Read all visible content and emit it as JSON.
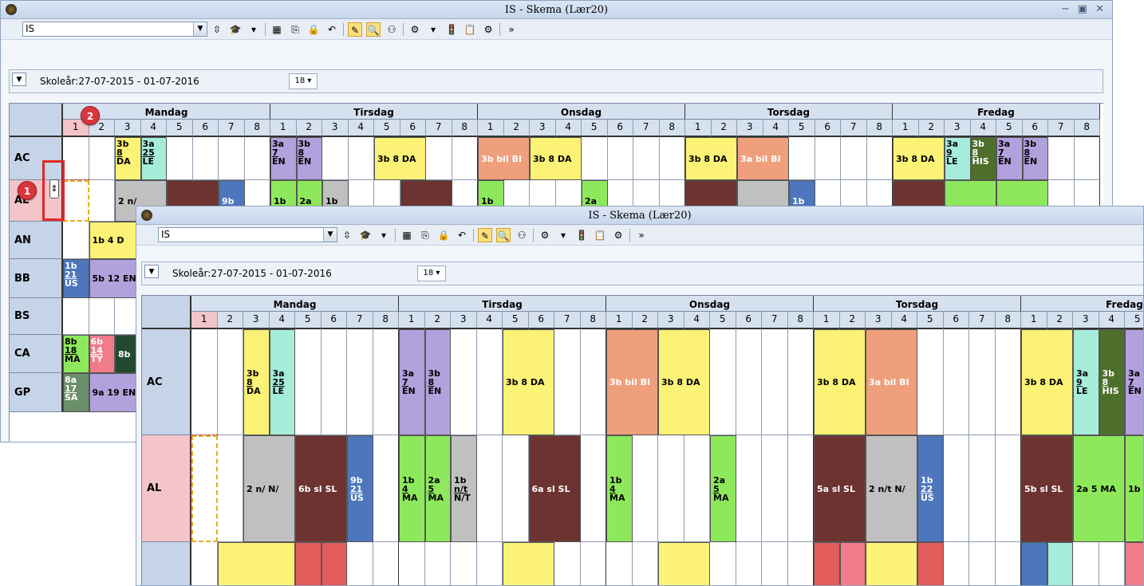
{
  "window_title": "IS -  Skema  (Lær20)",
  "window_controls": {
    "minimize": "−",
    "restore": "▣",
    "close": "✕"
  },
  "combo_value": "IS",
  "school_year": "Skoleår:27-07-2015 - 01-07-2016",
  "days": [
    "Mandag",
    "Tirsdag",
    "Onsdag",
    "Torsdag",
    "Fredag"
  ],
  "periods": [
    "1",
    "2",
    "3",
    "4",
    "5",
    "6",
    "7",
    "8"
  ],
  "teachers_back": [
    "AC",
    "AL",
    "AN",
    "BB",
    "BS",
    "CA",
    "GP"
  ],
  "teachers_front": [
    "AC",
    "AL"
  ],
  "badges": {
    "one": "1",
    "two": "2"
  },
  "toolbar_icons": [
    "stepper-icon",
    "graduation-cap-icon",
    "dropdown-icon",
    "grid-icon",
    "export-icon",
    "lock-icon",
    "undo-icon",
    "edit-highlight-icon",
    "search-icon",
    "people-icon",
    "settings-doc-icon",
    "dropdown-icon",
    "traffic-light-icon",
    "clipboard-icon",
    "gear-icon",
    "overflow-icon"
  ],
  "colors": {
    "yellow": "#fbf276",
    "teal": "#a6ecdb",
    "lilac": "#b1a1dc",
    "salmon": "#ef9f7c",
    "maroon": "#6c3331",
    "blue": "#4d76bd",
    "green": "#8ee85c",
    "grey": "#c0c0c0",
    "darkgreen": "#4e6f2a",
    "pink": "#f07c8a",
    "red": "#e25c5c",
    "forest": "#234a31",
    "olive": "#6b8e6b"
  },
  "lessons_back": [
    {
      "t": 0,
      "d": 0,
      "p": 2,
      "cls": "3b",
      "room": "8",
      "subj": "DA",
      "c": "yellow"
    },
    {
      "t": 0,
      "d": 0,
      "p": 3,
      "cls": "3a",
      "room": "25",
      "subj": "LE",
      "c": "teal"
    },
    {
      "t": 0,
      "d": 1,
      "p": 0,
      "cls": "3a",
      "room": "7",
      "subj": "EN",
      "c": "lilac"
    },
    {
      "t": 0,
      "d": 1,
      "p": 1,
      "cls": "3b",
      "room": "8",
      "subj": "EN",
      "c": "lilac"
    },
    {
      "t": 0,
      "d": 1,
      "p": 4,
      "span": 2,
      "text": "3b 8 DA",
      "c": "yellow"
    },
    {
      "t": 0,
      "d": 2,
      "p": 0,
      "span": 2,
      "text": "3b bil BI",
      "c": "salmon"
    },
    {
      "t": 0,
      "d": 2,
      "p": 2,
      "span": 2,
      "text": "3b 8 DA",
      "c": "yellow"
    },
    {
      "t": 0,
      "d": 3,
      "p": 0,
      "span": 2,
      "text": "3b 8 DA",
      "c": "yellow"
    },
    {
      "t": 0,
      "d": 3,
      "p": 2,
      "span": 2,
      "text": "3a bil BI",
      "c": "salmon"
    },
    {
      "t": 0,
      "d": 4,
      "p": 0,
      "span": 2,
      "text": "3b 8 DA",
      "c": "yellow"
    },
    {
      "t": 0,
      "d": 4,
      "p": 2,
      "cls": "3a",
      "room": "9",
      "subj": "LE",
      "c": "teal"
    },
    {
      "t": 0,
      "d": 4,
      "p": 3,
      "cls": "3b",
      "room": "8",
      "subj": "HIS",
      "c": "darkgreen"
    },
    {
      "t": 0,
      "d": 4,
      "p": 4,
      "cls": "3a",
      "room": "7",
      "subj": "EN",
      "c": "lilac"
    },
    {
      "t": 0,
      "d": 4,
      "p": 5,
      "cls": "3b",
      "room": "8",
      "subj": "EN",
      "c": "lilac"
    },
    {
      "t": 1,
      "d": 0,
      "p": 2,
      "span": 2,
      "text": "2 n/",
      "c": "grey"
    },
    {
      "t": 1,
      "d": 0,
      "p": 4,
      "span": 2,
      "text": "",
      "c": "maroon"
    },
    {
      "t": 1,
      "d": 0,
      "p": 6,
      "text": "9b",
      "c": "blue"
    },
    {
      "t": 1,
      "d": 1,
      "p": 0,
      "text": "1b",
      "c": "green"
    },
    {
      "t": 1,
      "d": 1,
      "p": 1,
      "text": "2a",
      "c": "green"
    },
    {
      "t": 1,
      "d": 1,
      "p": 2,
      "text": "1b",
      "c": "grey"
    },
    {
      "t": 1,
      "d": 1,
      "p": 5,
      "span": 2,
      "text": "",
      "c": "maroon"
    },
    {
      "t": 1,
      "d": 2,
      "p": 0,
      "text": "1b",
      "c": "green"
    },
    {
      "t": 1,
      "d": 2,
      "p": 4,
      "text": "2a",
      "c": "green"
    },
    {
      "t": 1,
      "d": 3,
      "p": 0,
      "span": 2,
      "text": "",
      "c": "maroon"
    },
    {
      "t": 1,
      "d": 3,
      "p": 2,
      "span": 2,
      "text": "",
      "c": "grey"
    },
    {
      "t": 1,
      "d": 3,
      "p": 4,
      "text": "1b",
      "c": "blue"
    },
    {
      "t": 1,
      "d": 4,
      "p": 0,
      "span": 2,
      "text": "",
      "c": "maroon"
    },
    {
      "t": 1,
      "d": 4,
      "p": 2,
      "span": 2,
      "text": "",
      "c": "green"
    },
    {
      "t": 1,
      "d": 4,
      "p": 4,
      "span": 2,
      "text": "",
      "c": "green"
    },
    {
      "t": 2,
      "d": 0,
      "p": 1,
      "span": 3,
      "text": "1b 4 D",
      "c": "yellow"
    },
    {
      "t": 3,
      "d": 0,
      "p": 0,
      "cls": "1b",
      "room": "21",
      "subj": "US",
      "c": "blue"
    },
    {
      "t": 3,
      "d": 0,
      "p": 1,
      "span": 2,
      "text": "5b 12 EN",
      "c": "lilac"
    },
    {
      "t": 5,
      "d": 0,
      "p": 0,
      "cls": "8b",
      "room": "18",
      "subj": "MA",
      "c": "green"
    },
    {
      "t": 5,
      "d": 0,
      "p": 1,
      "cls": "6b",
      "room": "14",
      "subj": "TY",
      "c": "pink"
    },
    {
      "t": 5,
      "d": 0,
      "p": 2,
      "text": "8b",
      "c": "forest"
    },
    {
      "t": 6,
      "d": 0,
      "p": 0,
      "cls": "8a",
      "room": "17",
      "subj": "SA",
      "c": "olive"
    },
    {
      "t": 6,
      "d": 0,
      "p": 1,
      "span": 2,
      "text": "9a 19 EN",
      "c": "lilac"
    }
  ],
  "lessons_front": [
    {
      "t": 0,
      "d": 0,
      "p": 2,
      "cls": "3b",
      "room": "8",
      "subj": "DA",
      "c": "yellow"
    },
    {
      "t": 0,
      "d": 0,
      "p": 3,
      "cls": "3a",
      "room": "25",
      "subj": "LE",
      "c": "teal"
    },
    {
      "t": 0,
      "d": 1,
      "p": 0,
      "cls": "3a",
      "room": "7",
      "subj": "EN",
      "c": "lilac"
    },
    {
      "t": 0,
      "d": 1,
      "p": 1,
      "cls": "3b",
      "room": "8",
      "subj": "EN",
      "c": "lilac"
    },
    {
      "t": 0,
      "d": 1,
      "p": 4,
      "span": 2,
      "text": "3b 8 DA",
      "c": "yellow"
    },
    {
      "t": 0,
      "d": 2,
      "p": 0,
      "span": 2,
      "text": "3b bil BI",
      "c": "salmon"
    },
    {
      "t": 0,
      "d": 2,
      "p": 2,
      "span": 2,
      "text": "3b 8 DA",
      "c": "yellow"
    },
    {
      "t": 0,
      "d": 3,
      "p": 0,
      "span": 2,
      "text": "3b 8 DA",
      "c": "yellow"
    },
    {
      "t": 0,
      "d": 3,
      "p": 2,
      "span": 2,
      "text": "3a bil BI",
      "c": "salmon"
    },
    {
      "t": 0,
      "d": 4,
      "p": 0,
      "span": 2,
      "text": "3b 8 DA",
      "c": "yellow"
    },
    {
      "t": 0,
      "d": 4,
      "p": 2,
      "cls": "3a",
      "room": "9",
      "subj": "LE",
      "c": "teal"
    },
    {
      "t": 0,
      "d": 4,
      "p": 3,
      "cls": "3b",
      "room": "8",
      "subj": "HIS",
      "c": "darkgreen"
    },
    {
      "t": 0,
      "d": 4,
      "p": 4,
      "cls": "3a",
      "room": "7",
      "subj": "EN",
      "c": "lilac"
    },
    {
      "t": 1,
      "d": 0,
      "p": 2,
      "span": 2,
      "text": "2 n/ N/",
      "c": "grey"
    },
    {
      "t": 1,
      "d": 0,
      "p": 4,
      "span": 2,
      "text": "6b sl SL",
      "c": "maroon"
    },
    {
      "t": 1,
      "d": 0,
      "p": 6,
      "cls": "9b",
      "room": "21",
      "subj": "US",
      "c": "blue"
    },
    {
      "t": 1,
      "d": 1,
      "p": 0,
      "cls": "1b",
      "room": "4",
      "subj": "MA",
      "c": "green"
    },
    {
      "t": 1,
      "d": 1,
      "p": 1,
      "cls": "2a",
      "room": "5",
      "subj": "MA",
      "c": "green"
    },
    {
      "t": 1,
      "d": 1,
      "p": 2,
      "cls": "1b",
      "room": "n/t",
      "subj": "N/T",
      "c": "grey"
    },
    {
      "t": 1,
      "d": 1,
      "p": 5,
      "span": 2,
      "text": "6a sl SL",
      "c": "maroon"
    },
    {
      "t": 1,
      "d": 2,
      "p": 0,
      "cls": "1b",
      "room": "4",
      "subj": "MA",
      "c": "green"
    },
    {
      "t": 1,
      "d": 2,
      "p": 4,
      "cls": "2a",
      "room": "5",
      "subj": "MA",
      "c": "green"
    },
    {
      "t": 1,
      "d": 3,
      "p": 0,
      "span": 2,
      "text": "5a sl SL",
      "c": "maroon"
    },
    {
      "t": 1,
      "d": 3,
      "p": 2,
      "span": 2,
      "text": "2 n/t N/",
      "c": "grey"
    },
    {
      "t": 1,
      "d": 3,
      "p": 4,
      "cls": "1b",
      "room": "22",
      "subj": "US",
      "c": "blue"
    },
    {
      "t": 1,
      "d": 4,
      "p": 0,
      "span": 2,
      "text": "5b sl SL",
      "c": "maroon"
    },
    {
      "t": 1,
      "d": 4,
      "p": 2,
      "span": 2,
      "text": "2a 5 MA",
      "c": "green"
    },
    {
      "t": 1,
      "d": 4,
      "p": 4,
      "text": "1b",
      "c": "green"
    }
  ],
  "row3_front": [
    {
      "d": 0,
      "p": 1,
      "span": 3,
      "c": "yellow"
    },
    {
      "d": 0,
      "p": 4,
      "c": "red"
    },
    {
      "d": 0,
      "p": 5,
      "c": "red"
    },
    {
      "d": 1,
      "p": 4,
      "span": 2,
      "c": "yellow"
    },
    {
      "d": 2,
      "p": 2,
      "span": 2,
      "c": "yellow"
    },
    {
      "d": 3,
      "p": 0,
      "c": "red"
    },
    {
      "d": 3,
      "p": 1,
      "c": "pink"
    },
    {
      "d": 3,
      "p": 2,
      "span": 2,
      "c": "yellow"
    },
    {
      "d": 3,
      "p": 4,
      "c": "red"
    },
    {
      "d": 4,
      "p": 0,
      "c": "blue"
    },
    {
      "d": 4,
      "p": 1,
      "c": "teal"
    },
    {
      "d": 4,
      "p": 4,
      "c": "pink"
    }
  ]
}
